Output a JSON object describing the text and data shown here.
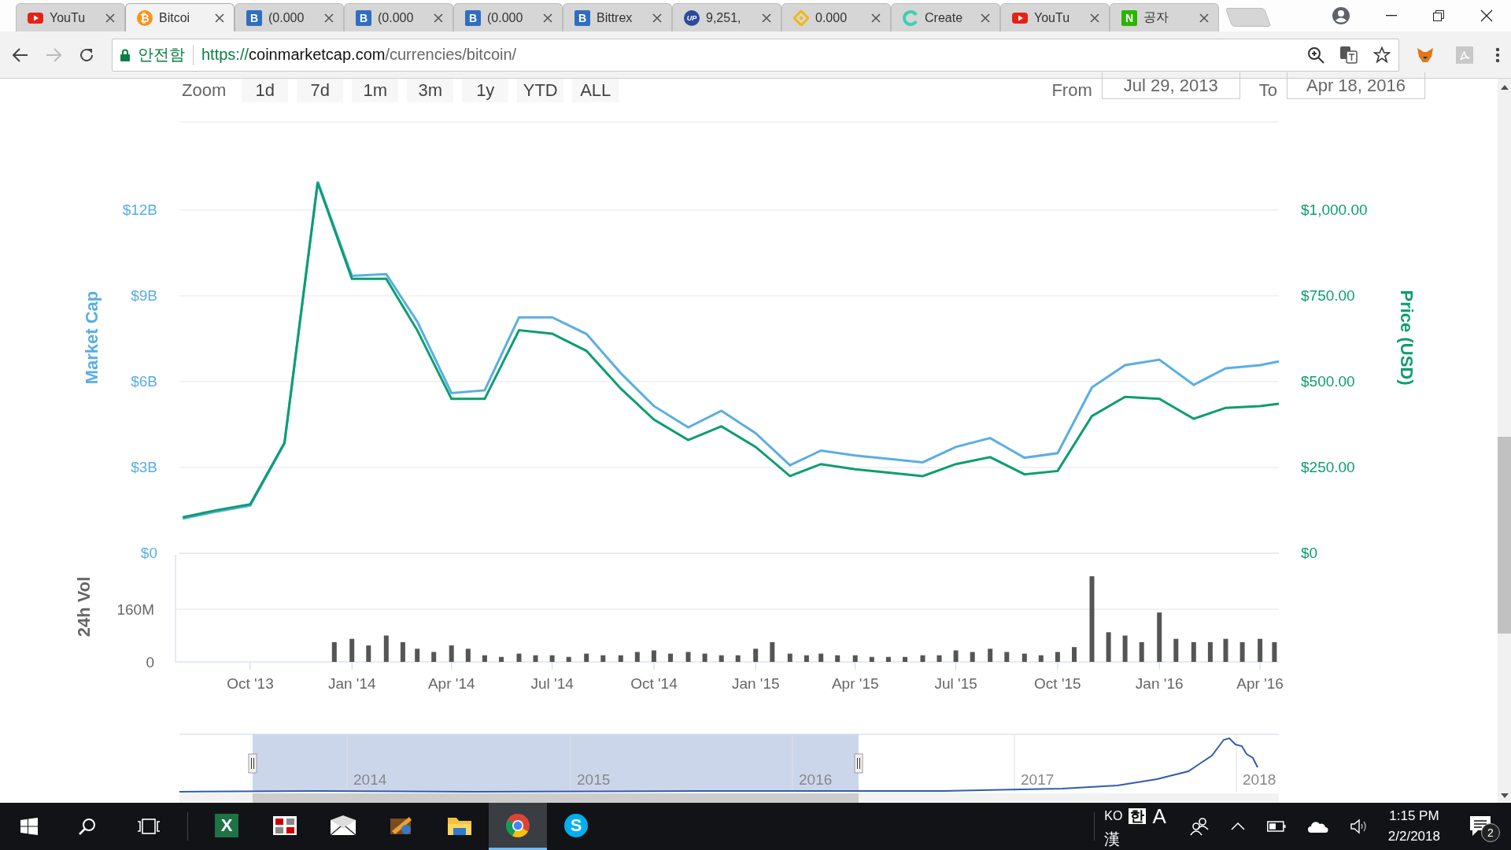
{
  "browser": {
    "tabs": [
      {
        "title": "YouTu",
        "kind": "youtube",
        "selected": false
      },
      {
        "title": "Bitcoi",
        "kind": "bitcoin",
        "icon_text": "₿",
        "selected": true
      },
      {
        "title": "(0.000",
        "kind": "letter",
        "icon_text": "B",
        "selected": false
      },
      {
        "title": "(0.000",
        "kind": "letter",
        "icon_text": "B",
        "selected": false
      },
      {
        "title": "(0.000",
        "kind": "letter",
        "icon_text": "B",
        "selected": false
      },
      {
        "title": "Bittrex",
        "kind": "letter",
        "icon_text": "B",
        "selected": false
      },
      {
        "title": "9,251,",
        "kind": "circle",
        "icon_text": "UP",
        "selected": false
      },
      {
        "title": "0.000",
        "kind": "diamond",
        "selected": false
      },
      {
        "title": "Create",
        "kind": "swirl",
        "selected": false
      },
      {
        "title": "YouTu",
        "kind": "youtube",
        "selected": false
      },
      {
        "title": "공자",
        "kind": "naver",
        "icon_text": "N",
        "selected": false
      }
    ],
    "security_label": "안전함",
    "url": {
      "scheme": "https://",
      "host": "coinmarketcap.com",
      "path": "/currencies/bitcoin/"
    }
  },
  "range_selector": {
    "label": "Zoom",
    "buttons": [
      "1d",
      "7d",
      "1m",
      "3m",
      "1y",
      "YTD",
      "ALL"
    ],
    "from_label": "From",
    "from": "Jul 29, 2013",
    "to_label": "To",
    "to": "Apr 18, 2016"
  },
  "price_chart": {
    "chart_data": {
      "type": "line",
      "grid": true,
      "xlim": [
        "2013-07-29",
        "2016-04-18"
      ],
      "ylim": [
        0,
        15.08
      ],
      "y2lim": [
        0,
        1257
      ],
      "yticks": [
        {
          "value": 0,
          "label": "$0"
        },
        {
          "value": 3,
          "label": "$3B"
        },
        {
          "value": 6,
          "label": "$6B"
        },
        {
          "value": 9,
          "label": "$9B"
        },
        {
          "value": 12,
          "label": "$12B"
        }
      ],
      "y2ticks": [
        {
          "value": 0,
          "label": "$0"
        },
        {
          "value": 250,
          "label": "$250.00"
        },
        {
          "value": 500,
          "label": "$500.00"
        },
        {
          "value": 750,
          "label": "$750.00"
        },
        {
          "value": 1000,
          "label": "$1,000.00"
        }
      ],
      "x": [
        "2013-08-01",
        "2013-09-01",
        "2013-10-01",
        "2013-11-01",
        "2013-12-01",
        "2014-01-01",
        "2014-02-01",
        "2014-03-01",
        "2014-04-01",
        "2014-05-01",
        "2014-06-01",
        "2014-07-01",
        "2014-08-01",
        "2014-09-01",
        "2014-10-01",
        "2014-11-01",
        "2014-12-01",
        "2015-01-01",
        "2015-02-01",
        "2015-03-01",
        "2015-04-01",
        "2015-05-01",
        "2015-06-01",
        "2015-07-01",
        "2015-08-01",
        "2015-09-01",
        "2015-10-01",
        "2015-11-01",
        "2015-12-01",
        "2016-01-01",
        "2016-02-01",
        "2016-03-01",
        "2016-04-01",
        "2016-04-18"
      ],
      "series": [
        {
          "name": "Market Cap",
          "color": "#5aaee2",
          "values": [
            1.21,
            1.46,
            1.67,
            3.84,
            13.0,
            9.7,
            9.76,
            8.1,
            5.6,
            5.7,
            8.25,
            8.25,
            7.67,
            6.3,
            5.15,
            4.4,
            4.98,
            4.2,
            3.08,
            3.59,
            3.42,
            3.3,
            3.18,
            3.72,
            4.03,
            3.34,
            3.5,
            5.8,
            6.58,
            6.77,
            5.89,
            6.47,
            6.58,
            6.71
          ]
        },
        {
          "name": "Price (USD)",
          "color": "#0b9e6f",
          "axis": "y2",
          "values": [
            105,
            126,
            143,
            322,
            1080,
            800,
            800,
            650,
            450,
            450,
            650,
            640,
            590,
            480,
            390,
            330,
            370,
            310,
            225,
            260,
            245,
            235,
            225,
            260,
            280,
            230,
            240,
            400,
            456,
            450,
            392,
            424,
            429,
            436
          ]
        }
      ]
    }
  },
  "volume_chart": {
    "chart_data": {
      "type": "bar",
      "grid": true,
      "xlim": [
        "2013-07-29",
        "2016-04-18"
      ],
      "ylim": [
        0,
        325
      ],
      "yticks": [
        {
          "value": 0,
          "label": "0"
        },
        {
          "value": 160,
          "label": "160M"
        }
      ],
      "x": [
        "2013-12-16",
        "2014-01-01",
        "2014-01-16",
        "2014-02-01",
        "2014-02-16",
        "2014-03-01",
        "2014-03-16",
        "2014-04-01",
        "2014-04-16",
        "2014-05-01",
        "2014-05-16",
        "2014-06-01",
        "2014-06-16",
        "2014-07-01",
        "2014-07-16",
        "2014-08-01",
        "2014-08-16",
        "2014-09-01",
        "2014-09-16",
        "2014-10-01",
        "2014-10-16",
        "2014-11-01",
        "2014-11-16",
        "2014-12-01",
        "2014-12-16",
        "2015-01-01",
        "2015-01-16",
        "2015-02-01",
        "2015-02-16",
        "2015-03-01",
        "2015-03-16",
        "2015-04-01",
        "2015-04-16",
        "2015-05-01",
        "2015-05-16",
        "2015-06-01",
        "2015-06-16",
        "2015-07-01",
        "2015-07-16",
        "2015-08-01",
        "2015-08-16",
        "2015-09-01",
        "2015-09-16",
        "2015-10-01",
        "2015-10-16",
        "2015-11-01",
        "2015-11-16",
        "2015-12-01",
        "2015-12-16",
        "2016-01-01",
        "2016-01-16",
        "2016-02-01",
        "2016-02-16",
        "2016-03-01",
        "2016-03-16",
        "2016-04-01",
        "2016-04-14"
      ],
      "xticks": [
        {
          "value": "2013-10-01",
          "label": "Oct '13"
        },
        {
          "value": "2014-01-01",
          "label": "Jan '14"
        },
        {
          "value": "2014-04-01",
          "label": "Apr '14"
        },
        {
          "value": "2014-07-01",
          "label": "Jul '14"
        },
        {
          "value": "2014-10-01",
          "label": "Oct '14"
        },
        {
          "value": "2015-01-01",
          "label": "Jan '15"
        },
        {
          "value": "2015-04-01",
          "label": "Apr '15"
        },
        {
          "value": "2015-07-01",
          "label": "Jul '15"
        },
        {
          "value": "2015-10-01",
          "label": "Oct '15"
        },
        {
          "value": "2016-01-01",
          "label": "Jan '16"
        },
        {
          "value": "2016-04-01",
          "label": "Apr '16"
        }
      ],
      "series": [
        {
          "name": "24h Vol",
          "color": "#555555",
          "values": [
            60,
            70,
            50,
            80,
            60,
            40,
            30,
            50,
            40,
            20,
            15,
            25,
            20,
            20,
            15,
            25,
            20,
            20,
            30,
            35,
            25,
            30,
            25,
            20,
            20,
            40,
            60,
            25,
            20,
            25,
            20,
            20,
            15,
            15,
            15,
            20,
            20,
            35,
            30,
            40,
            30,
            25,
            20,
            30,
            45,
            260,
            90,
            80,
            60,
            150,
            70,
            60,
            60,
            70,
            60,
            70,
            60
          ]
        }
      ]
    }
  },
  "navigator": {
    "years": [
      "2014",
      "2015",
      "2016",
      "2017",
      "2018"
    ]
  },
  "taskbar": {
    "apps": [
      {
        "kind": "excel",
        "icon_text": "X",
        "selected": false
      },
      {
        "kind": "grid",
        "selected": false
      },
      {
        "kind": "mail",
        "selected": false
      },
      {
        "kind": "tool",
        "selected": false
      },
      {
        "kind": "folder",
        "selected": false
      },
      {
        "kind": "chrome",
        "selected": true
      },
      {
        "kind": "skype",
        "icon_text": "S",
        "selected": false
      }
    ],
    "ime": {
      "language": "KO",
      "mode": "한",
      "width": "A",
      "hanja": "漢"
    },
    "time": "1:15 PM",
    "date": "2/2/2018",
    "notifications": "2"
  }
}
